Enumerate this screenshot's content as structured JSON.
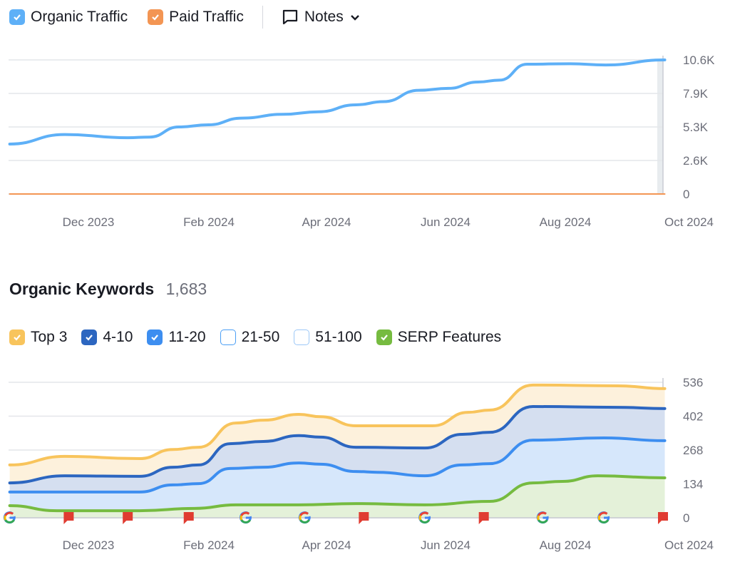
{
  "traffic_legend": {
    "items": [
      {
        "label": "Organic Traffic",
        "color": "#5eb0f7",
        "checked": true
      },
      {
        "label": "Paid Traffic",
        "color": "#f39553",
        "checked": true
      }
    ],
    "notes_label": "Notes"
  },
  "keywords": {
    "title": "Organic Keywords",
    "count": "1,683"
  },
  "keyword_legend": [
    {
      "label": "Top 3",
      "color": "#f8c45c",
      "checked": true
    },
    {
      "label": "4-10",
      "color": "#2c66c0",
      "checked": true
    },
    {
      "label": "11-20",
      "color": "#3d8ef0",
      "checked": true
    },
    {
      "label": "21-50",
      "color": "#4a9ef5",
      "checked": false
    },
    {
      "label": "51-100",
      "color": "#9cc8f7",
      "checked": false
    },
    {
      "label": "SERP Features",
      "color": "#76bb40",
      "checked": true
    }
  ],
  "chart_data": [
    {
      "type": "line",
      "x_ticks": [
        "Dec 2023",
        "Feb 2024",
        "Apr 2024",
        "Jun 2024",
        "Aug 2024",
        "Oct 2024"
      ],
      "y_ticks": [
        "0",
        "2.6K",
        "5.3K",
        "7.9K",
        "10.6K"
      ],
      "ylim": [
        0,
        10600
      ],
      "grid": true,
      "series": [
        {
          "name": "Organic Traffic",
          "color": "#5eb0f7",
          "points": [
            [
              "2023-10-22",
              3950
            ],
            [
              "2023-11-19",
              4700
            ],
            [
              "2023-12-21",
              4450
            ],
            [
              "2024-01-01",
              4500
            ],
            [
              "2024-01-16",
              5300
            ],
            [
              "2024-01-31",
              5470
            ],
            [
              "2024-02-17",
              6000
            ],
            [
              "2024-03-09",
              6300
            ],
            [
              "2024-03-27",
              6500
            ],
            [
              "2024-04-15",
              7050
            ],
            [
              "2024-04-29",
              7300
            ],
            [
              "2024-05-17",
              8200
            ],
            [
              "2024-06-01",
              8350
            ],
            [
              "2024-06-16",
              8850
            ],
            [
              "2024-06-27",
              9000
            ],
            [
              "2024-07-11",
              10260
            ],
            [
              "2024-08-02",
              10300
            ],
            [
              "2024-08-20",
              10200
            ],
            [
              "2024-09-19",
              10600
            ]
          ]
        },
        {
          "name": "Paid Traffic",
          "color": "#f39553",
          "points": [
            [
              "2023-10-22",
              0
            ],
            [
              "2024-09-19",
              0
            ]
          ]
        }
      ]
    },
    {
      "type": "area",
      "stacked": true,
      "x_ticks": [
        "Dec 2023",
        "Feb 2024",
        "Apr 2024",
        "Jun 2024",
        "Aug 2024",
        "Oct 2024"
      ],
      "y_ticks": [
        "0",
        "134",
        "268",
        "402",
        "536"
      ],
      "ylim": [
        0,
        536
      ],
      "grid": true,
      "series": [
        {
          "name": "Top 3",
          "color": "#f8c45c",
          "fill": "#fdf1dc",
          "points": [
            [
              "2023-10-22",
              209
            ],
            [
              "2023-11-19",
              243
            ],
            [
              "2023-12-27",
              234
            ],
            [
              "2024-01-13",
              270
            ],
            [
              "2024-01-26",
              279
            ],
            [
              "2024-02-14",
              375
            ],
            [
              "2024-02-28",
              386
            ],
            [
              "2024-03-17",
              409
            ],
            [
              "2024-03-28",
              400
            ],
            [
              "2024-04-15",
              364
            ],
            [
              "2024-05-24",
              364
            ],
            [
              "2024-06-11",
              417
            ],
            [
              "2024-06-22",
              426
            ],
            [
              "2024-07-14",
              525
            ],
            [
              "2024-08-26",
              522
            ],
            [
              "2024-09-19",
              511
            ]
          ]
        },
        {
          "name": "4-10",
          "color": "#2c66c0",
          "fill": "#d5dff0",
          "points": [
            [
              "2023-10-22",
              138
            ],
            [
              "2023-11-19",
              166
            ],
            [
              "2023-12-27",
              164
            ],
            [
              "2024-01-13",
              200
            ],
            [
              "2024-01-26",
              209
            ],
            [
              "2024-02-11",
              293
            ],
            [
              "2024-02-28",
              302
            ],
            [
              "2024-03-17",
              325
            ],
            [
              "2024-03-28",
              319
            ],
            [
              "2024-04-15",
              279
            ],
            [
              "2024-05-20",
              276
            ],
            [
              "2024-06-08",
              330
            ],
            [
              "2024-06-22",
              338
            ],
            [
              "2024-07-14",
              440
            ],
            [
              "2024-08-26",
              437
            ],
            [
              "2024-09-19",
              432
            ]
          ]
        },
        {
          "name": "11-20",
          "color": "#3d8ef0",
          "fill": "#d6e7fb",
          "points": [
            [
              "2023-10-22",
              102
            ],
            [
              "2023-12-27",
              102
            ],
            [
              "2024-01-13",
              130
            ],
            [
              "2024-01-26",
              135
            ],
            [
              "2024-02-11",
              195
            ],
            [
              "2024-02-28",
              200
            ],
            [
              "2024-03-17",
              217
            ],
            [
              "2024-03-28",
              212
            ],
            [
              "2024-04-15",
              183
            ],
            [
              "2024-04-26",
              180
            ],
            [
              "2024-05-20",
              166
            ],
            [
              "2024-06-08",
              209
            ],
            [
              "2024-06-22",
              214
            ],
            [
              "2024-07-14",
              307
            ],
            [
              "2024-08-19",
              316
            ],
            [
              "2024-09-19",
              305
            ]
          ]
        },
        {
          "name": "SERP Features",
          "color": "#76bb40",
          "fill": "#e4f1d9",
          "points": [
            [
              "2023-10-22",
              48
            ],
            [
              "2023-11-15",
              28
            ],
            [
              "2023-12-27",
              28
            ],
            [
              "2024-01-24",
              37
            ],
            [
              "2024-02-14",
              51
            ],
            [
              "2024-03-17",
              51
            ],
            [
              "2024-04-15",
              56
            ],
            [
              "2024-05-20",
              51
            ],
            [
              "2024-06-22",
              65
            ],
            [
              "2024-07-14",
              138
            ],
            [
              "2024-07-29",
              144
            ],
            [
              "2024-08-16",
              166
            ],
            [
              "2024-09-19",
              158
            ]
          ]
        }
      ],
      "markers": [
        {
          "type": "google-update",
          "date": "2023-10-22"
        },
        {
          "type": "note-flag",
          "date": "2023-11-21"
        },
        {
          "type": "note-flag",
          "date": "2023-12-21"
        },
        {
          "type": "note-flag",
          "date": "2024-01-21"
        },
        {
          "type": "google-update",
          "date": "2024-02-19"
        },
        {
          "type": "google-update",
          "date": "2024-03-20"
        },
        {
          "type": "note-flag",
          "date": "2024-04-19"
        },
        {
          "type": "google-update",
          "date": "2024-05-20"
        },
        {
          "type": "note-flag",
          "date": "2024-06-19"
        },
        {
          "type": "google-update",
          "date": "2024-07-19"
        },
        {
          "type": "google-update",
          "date": "2024-08-19"
        },
        {
          "type": "note-flag",
          "date": "2024-09-19"
        }
      ]
    }
  ]
}
